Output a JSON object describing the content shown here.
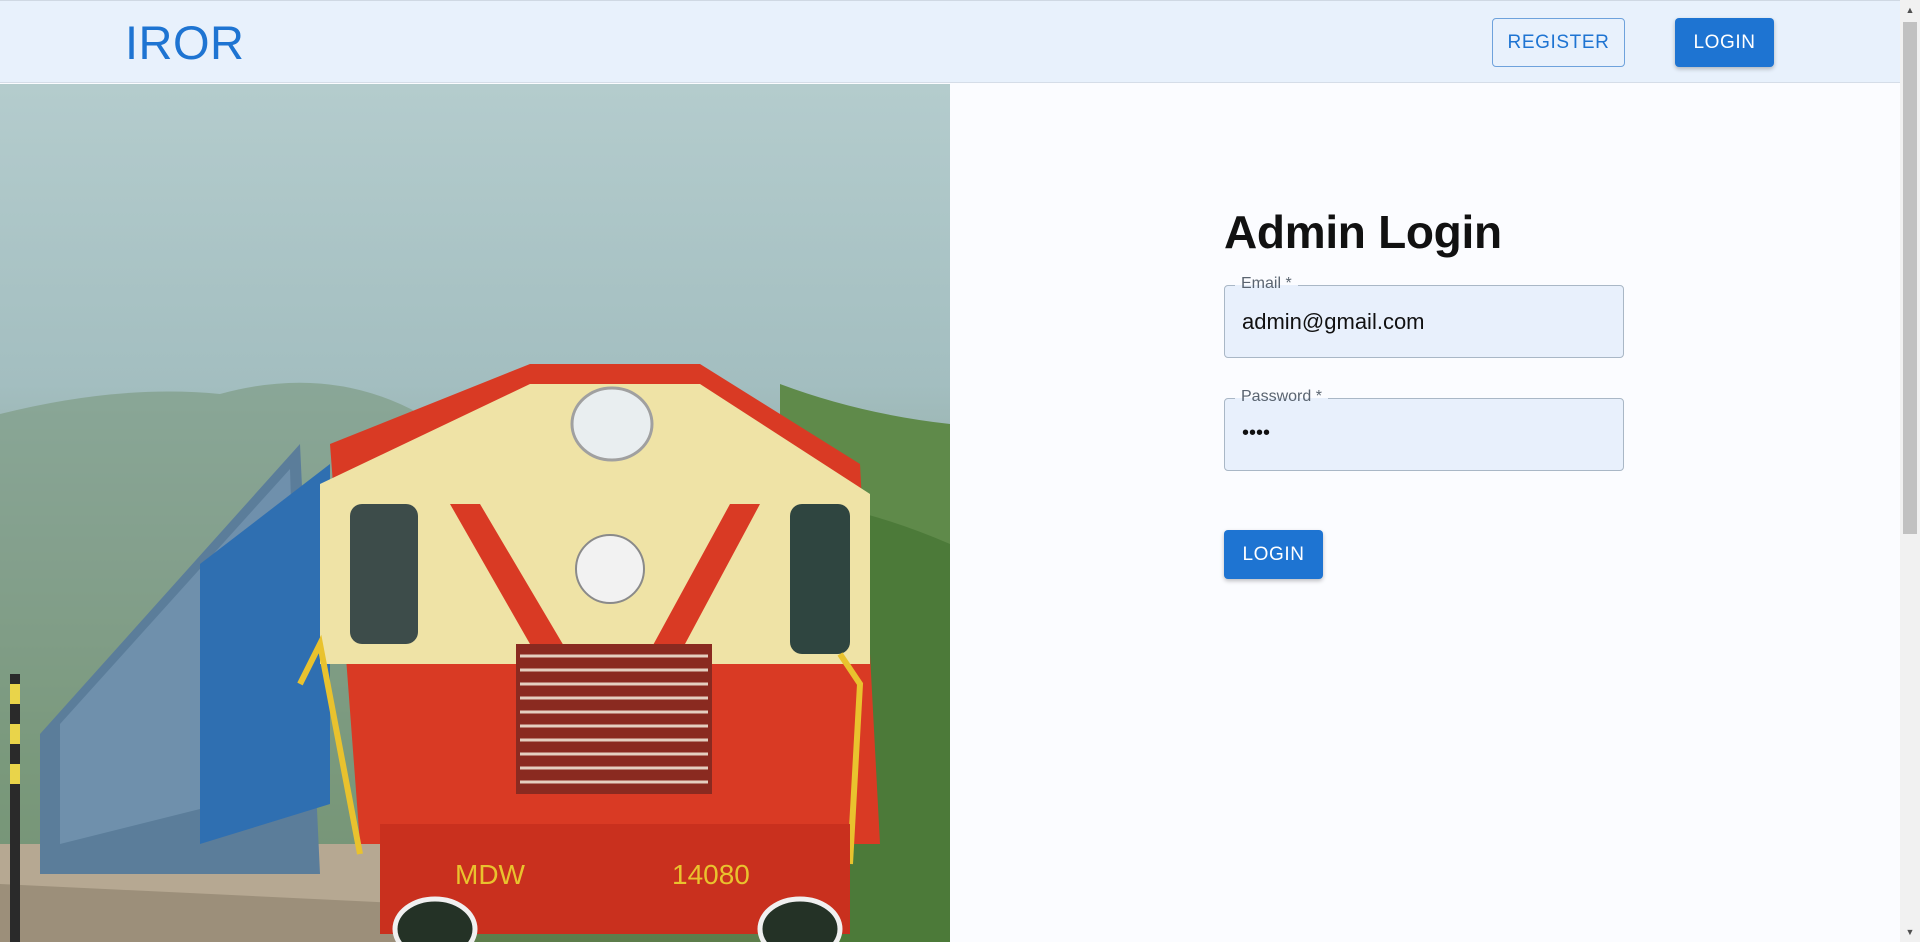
{
  "header": {
    "brand": "IROR",
    "register_label": "REGISTER",
    "login_label": "LOGIN"
  },
  "hero": {
    "image_alt": "Red and cream diesel locomotive on railway track",
    "locomotive_marking_left": "MDW",
    "locomotive_marking_right": "14080"
  },
  "form": {
    "title": "Admin Login",
    "email_label": "Email *",
    "email_value": "admin@gmail.com",
    "password_label": "Password *",
    "password_value": "••••",
    "submit_label": "LOGIN"
  },
  "colors": {
    "primary": "#1e74d2",
    "appbar_bg": "#e8f1fc",
    "field_bg": "#e8f0fc"
  }
}
